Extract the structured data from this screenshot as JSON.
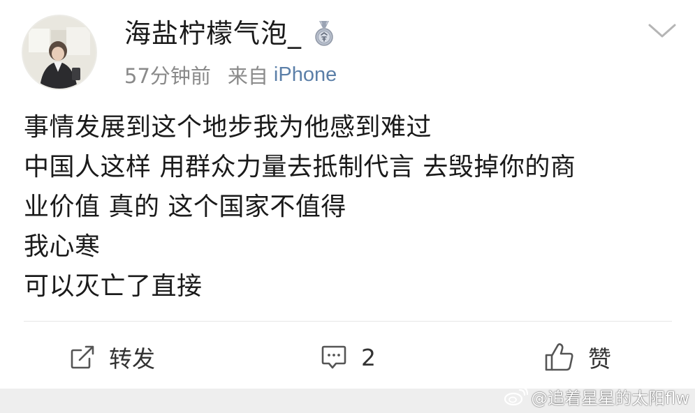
{
  "header": {
    "username": "海盐柠檬气泡_",
    "time": "57分钟前",
    "from_label": "来自",
    "device": "iPhone",
    "medal_icon": "medal-icon",
    "menu_icon": "chevron-down-icon"
  },
  "post": {
    "lines": [
      "事情发展到这个地步我为他感到难过",
      "中国人这样 用群众力量去抵制代言 去毁掉你的商",
      "业价值 真的 这个国家不值得",
      "我心寒",
      "可以灭亡了直接"
    ]
  },
  "actions": {
    "repost_label": "转发",
    "comment_count": "2",
    "like_label": "赞"
  },
  "watermark": {
    "text": "@追着星星的太阳flw"
  },
  "colors": {
    "text": "#1a1a1a",
    "meta": "#8a8a8a",
    "device_link": "#5b7fa8",
    "divider": "#e6e6e6",
    "bottom_strip": "#eeeeee"
  }
}
